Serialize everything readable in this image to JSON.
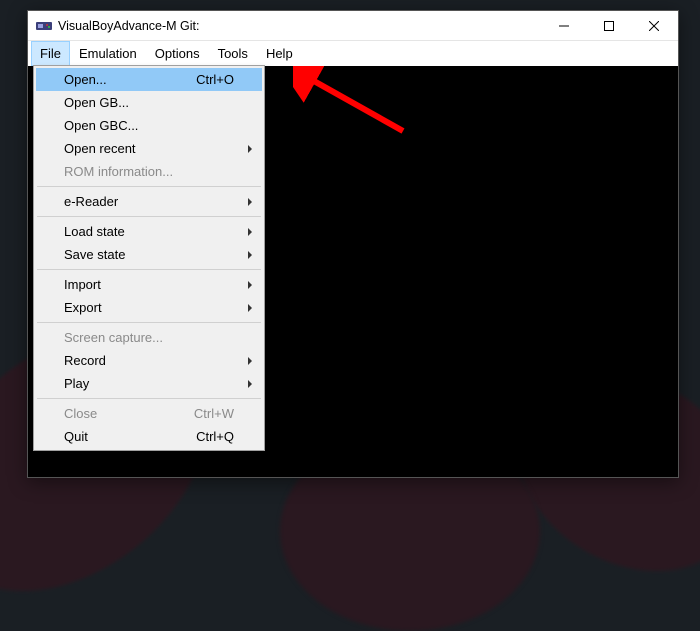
{
  "titlebar": {
    "title": "VisualBoyAdvance-M Git:"
  },
  "menubar": {
    "items": [
      {
        "label": "File",
        "open": true
      },
      {
        "label": "Emulation",
        "open": false
      },
      {
        "label": "Options",
        "open": false
      },
      {
        "label": "Tools",
        "open": false
      },
      {
        "label": "Help",
        "open": false
      }
    ]
  },
  "file_menu": [
    {
      "label": "Open...",
      "shortcut": "Ctrl+O",
      "highlight": true
    },
    {
      "label": "Open GB..."
    },
    {
      "label": "Open GBC..."
    },
    {
      "label": "Open recent",
      "submenu": true
    },
    {
      "label": "ROM information...",
      "disabled": true
    },
    {
      "sep": true
    },
    {
      "label": "e-Reader",
      "submenu": true
    },
    {
      "sep": true
    },
    {
      "label": "Load state",
      "submenu": true
    },
    {
      "label": "Save state",
      "submenu": true
    },
    {
      "sep": true
    },
    {
      "label": "Import",
      "submenu": true
    },
    {
      "label": "Export",
      "submenu": true
    },
    {
      "sep": true
    },
    {
      "label": "Screen capture...",
      "disabled": true
    },
    {
      "label": "Record",
      "submenu": true
    },
    {
      "label": "Play",
      "submenu": true
    },
    {
      "sep": true
    },
    {
      "label": "Close",
      "shortcut": "Ctrl+W",
      "disabled": true
    },
    {
      "label": "Quit",
      "shortcut": "Ctrl+Q"
    }
  ]
}
